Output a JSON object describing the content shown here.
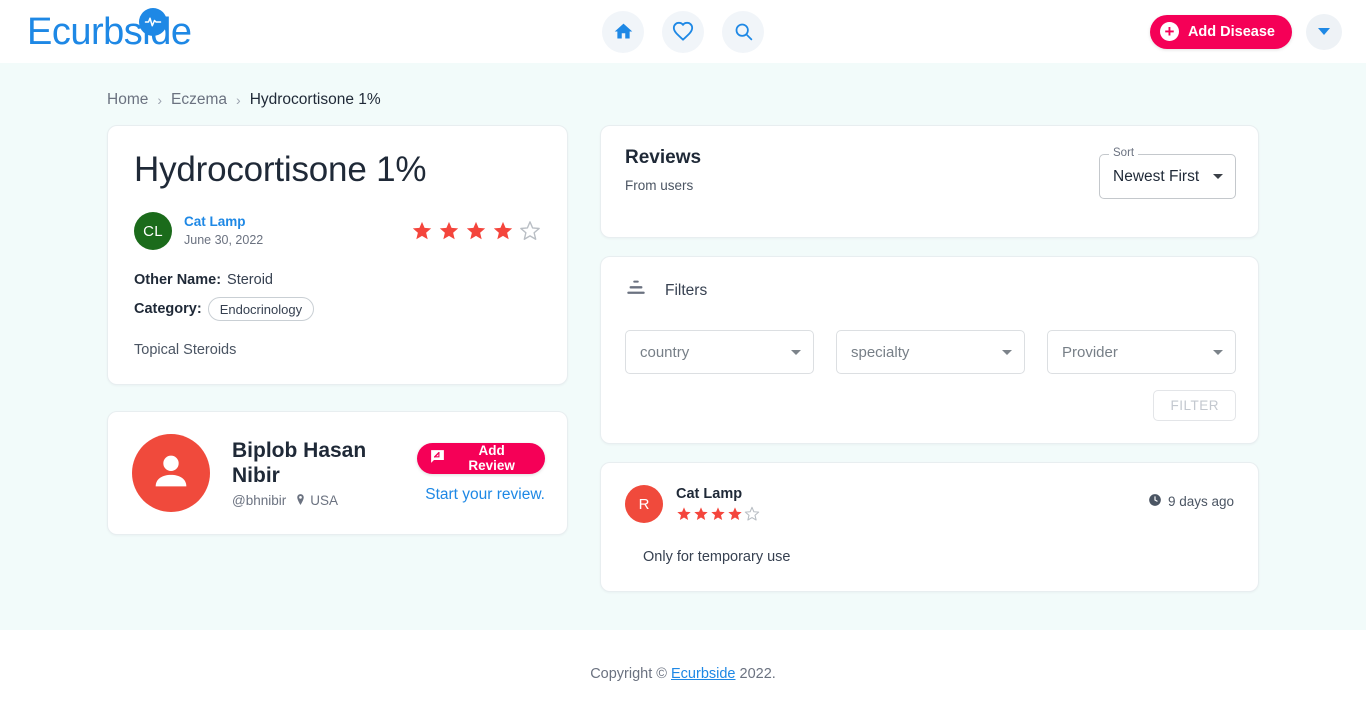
{
  "header": {
    "brand_text": "Ecurbside",
    "brand_icon": "pulse-badge-icon",
    "nav": [
      {
        "name": "home-icon",
        "label": "Home"
      },
      {
        "name": "heart-icon",
        "label": "Favorites"
      },
      {
        "name": "search-icon",
        "label": "Search"
      }
    ],
    "add_disease_label": "Add Disease",
    "add_disease_icon": "plus-circle-icon",
    "account_caret_icon": "chevron-down-icon",
    "accent_color": "#f50057",
    "brand_color": "#1e88e5"
  },
  "breadcrumb": {
    "items": [
      "Home",
      "Eczema",
      "Hydrocortisone 1%"
    ],
    "separator": "›"
  },
  "product": {
    "title": "Hydrocortisone 1%",
    "author": {
      "initials": "CL",
      "name": "Cat Lamp",
      "date": "June 30, 2022",
      "avatar_color": "#1b6b1b"
    },
    "rating": 4,
    "rating_max": 5,
    "star_color": "#f4453c",
    "other_name_label": "Other Name:",
    "other_name_value": "Steroid",
    "category_label": "Category:",
    "category_value": "Endocrinology",
    "description": "Topical Steroids"
  },
  "profile": {
    "avatar_icon": "person-icon",
    "avatar_color": "#f04a3c",
    "name": "Biplob Hasan Nibir",
    "handle": "@bhnibir",
    "location": "USA",
    "location_icon": "map-pin-icon",
    "add_review_label": "Add Review",
    "add_review_icon": "review-message-icon",
    "start_review_label": "Start your review."
  },
  "reviews": {
    "title": "Reviews",
    "subtitle": "From users",
    "sort": {
      "legend": "Sort",
      "value": "Newest First",
      "caret_icon": "chevron-down-icon"
    },
    "filters": {
      "icon": "filter-tune-icon",
      "label": "Filters",
      "selects": [
        {
          "name": "country-filter",
          "placeholder": "country"
        },
        {
          "name": "specialty-filter",
          "placeholder": "specialty"
        },
        {
          "name": "provider-filter",
          "placeholder": "Provider"
        }
      ],
      "button_label": "FILTER",
      "button_disabled": true
    },
    "items": [
      {
        "initials": "R",
        "avatar_color": "#f04a3c",
        "name": "Cat Lamp",
        "rating": 4,
        "rating_max": 5,
        "time_icon": "clock-icon",
        "time": "9 days ago",
        "body": "Only for temporary use"
      }
    ]
  },
  "footer": {
    "prefix": "Copyright © ",
    "link": "Ecurbside",
    "suffix": " 2022."
  }
}
